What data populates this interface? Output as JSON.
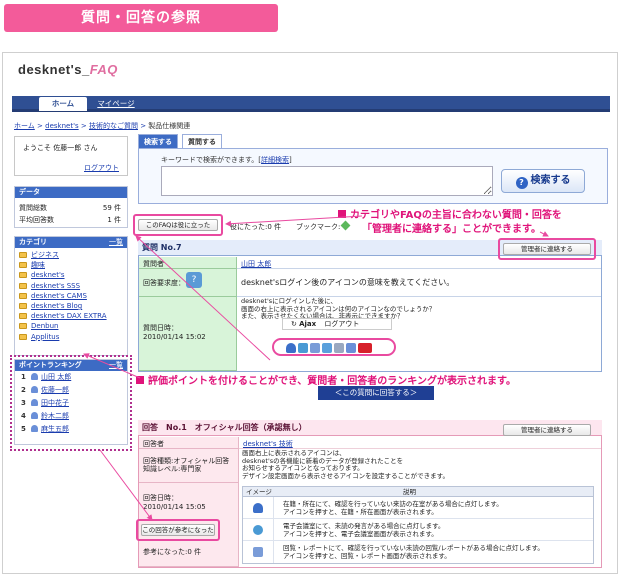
{
  "banner": "質問・回答の参照",
  "logo": {
    "main": "desknet's",
    "faq": "FAQ"
  },
  "nav": {
    "home": "ホーム",
    "mypage": "マイページ"
  },
  "breadcrumb": [
    "ホーム",
    "desknet's",
    "技術的なご質問",
    "製品仕様関連"
  ],
  "welcome": {
    "text": "ようこそ 佐藤一郎 さん",
    "logout": "ログアウト"
  },
  "data_panel": {
    "title": "データ",
    "rows": [
      {
        "label": "質問総数",
        "value": "59 件"
      },
      {
        "label": "平均回答数",
        "value": "1 件"
      }
    ]
  },
  "category": {
    "title": "カテゴリ",
    "list_link": "一覧",
    "items": [
      "ビジネス",
      "趣味",
      "desknet's",
      "desknet's SSS",
      "desknet's CAMS",
      "desknet's Blog",
      "desknet's DAX EXTRA",
      "Denbun",
      "Applitus"
    ]
  },
  "ranking": {
    "title": "ポイントランキング",
    "list_link": "一覧",
    "items": [
      {
        "no": "1",
        "name": "山田 太郎"
      },
      {
        "no": "2",
        "name": "佐藤一郎"
      },
      {
        "no": "3",
        "name": "田中花子"
      },
      {
        "no": "4",
        "name": "鈴木二郎"
      },
      {
        "no": "5",
        "name": "麻生五郎"
      }
    ]
  },
  "search": {
    "tab_search": "検索する",
    "tab_ask": "質問する",
    "label": "キーワードで検索ができます。[",
    "detail_link": "詳細検索",
    "label_end": "]",
    "button": "検索する"
  },
  "helped_button": "このFAQは役に立った",
  "helped_count": "役にたった:0 件",
  "bookmark": "ブックマーク:",
  "note1": {
    "line1": "カテゴリやFAQの主旨に合わない質問・回答を",
    "line2": "「管理者に連絡する」ことができます。"
  },
  "question": {
    "title": "質問 No.7",
    "manager_button": "管理者に連絡する",
    "asker_label": "質問者",
    "asker": "山田 太郎",
    "urgency_label": "回答要求度：",
    "subject": "desknet'sログイン後のアイコンの意味を教えてください。",
    "date_label": "質問日時：",
    "date": "2010/01/14 15:02",
    "body": [
      "desknet'sにログインした後に、",
      "画面の右上に表示されるアイコンは何のアイコンなのでしょうか？",
      "また、表示させたくない場合は、非表示にできますか？"
    ],
    "ajax": "Ajax",
    "logout": "ログアウト"
  },
  "note2": "評価ポイントを付けることができ、質問者・回答者のランキングが表示されます。",
  "answer_button": "＜この質問に回答する＞",
  "answer": {
    "title": "回答　No.1　オフィシャル回答（承認無し）",
    "manager_button": "管理者に連絡する",
    "answerer_label": "回答者",
    "answerer": "desknet's 技術",
    "type_label": [
      "回答種類:オフィシャル回答",
      "知識レベル:専門家"
    ],
    "body": [
      "画面右上に表示されるアイコンは、",
      "desknet'sの各機能に新着のデータが登録されたことを",
      "お知らせするアイコンとなっております。",
      "デザイン設定画面から表示させるアイコンを設定することができます。"
    ],
    "date_label": "回答日時：",
    "date": "2010/01/14 15:05",
    "ref_button": "この回答が参考になった",
    "ref_count": "参考になった:0 件",
    "table_head": {
      "image": "イメージ",
      "desc": "説明"
    },
    "rows": [
      {
        "icon": "person-icon",
        "l1": "在籍・所在にて、確認を行っていない来訪の在室がある場合に点灯します。",
        "l2": "アイコンを押すと、在籍・所在画面が表示されます。"
      },
      {
        "icon": "phone-icon",
        "l1": "電子会議室にて、未読の発言がある場合に点灯します。",
        "l2": "アイコンを押すと、電子会議室画面が表示されます。"
      },
      {
        "icon": "memo-icon",
        "l1": "回覧・レポートにて、確認を行っていない未読の回覧/レポートがある場合に点灯します。",
        "l2": "アイコンを押すと、回覧・レポート画面が表示されます。"
      }
    ]
  },
  "colors": {
    "banner": "#f35b9a",
    "nav": "#2f4f93",
    "accent": "#e0137a",
    "question_head": "#e4ecfa",
    "answer_head": "#fde6ef"
  }
}
